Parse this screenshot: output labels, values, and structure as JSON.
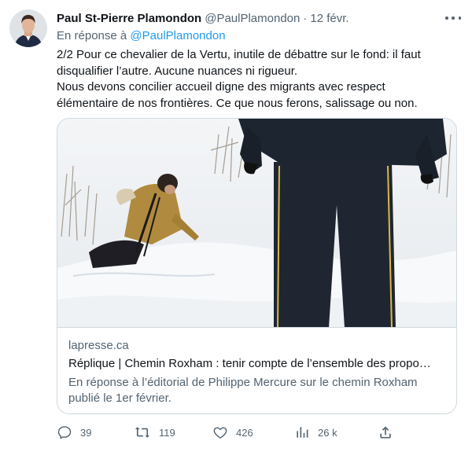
{
  "tweet": {
    "author_name": "Paul St-Pierre Plamondon",
    "author_handle": "@PaulPlamondon",
    "separator": "·",
    "date": "12 févr.",
    "reply_prefix": "En réponse à",
    "reply_to": "@PaulPlamondon",
    "text_lines": [
      "2/2 Pour ce chevalier de la Vertu, inutile de débattre sur le fond: il faut",
      "disqualifier l’autre. Aucune nuances ni rigueur.",
      "Nous devons concilier accueil digne des migrants avec respect",
      "élémentaire de nos frontières. Ce que nous ferons, salissage ou non."
    ]
  },
  "card": {
    "domain": "lapresse.ca",
    "title": "Réplique | Chemin Roxham : tenir compte de l’ensemble des propo…",
    "description_lines": [
      "En réponse à l’éditorial de Philippe Mercure sur le chemin Roxham",
      "publié le 1er février."
    ]
  },
  "actions": {
    "replies": "39",
    "retweets": "119",
    "likes": "426",
    "views": "26 k"
  },
  "icons": {
    "reply": "comment-icon",
    "retweet": "retweet-icon",
    "like": "heart-icon",
    "views": "views-bar-chart-icon",
    "share": "share-upload-icon",
    "more": "more-dots-icon"
  },
  "colors": {
    "text": "#0f1419",
    "secondary": "#536471",
    "link": "#1d9bf0",
    "border": "#cfd9de"
  }
}
